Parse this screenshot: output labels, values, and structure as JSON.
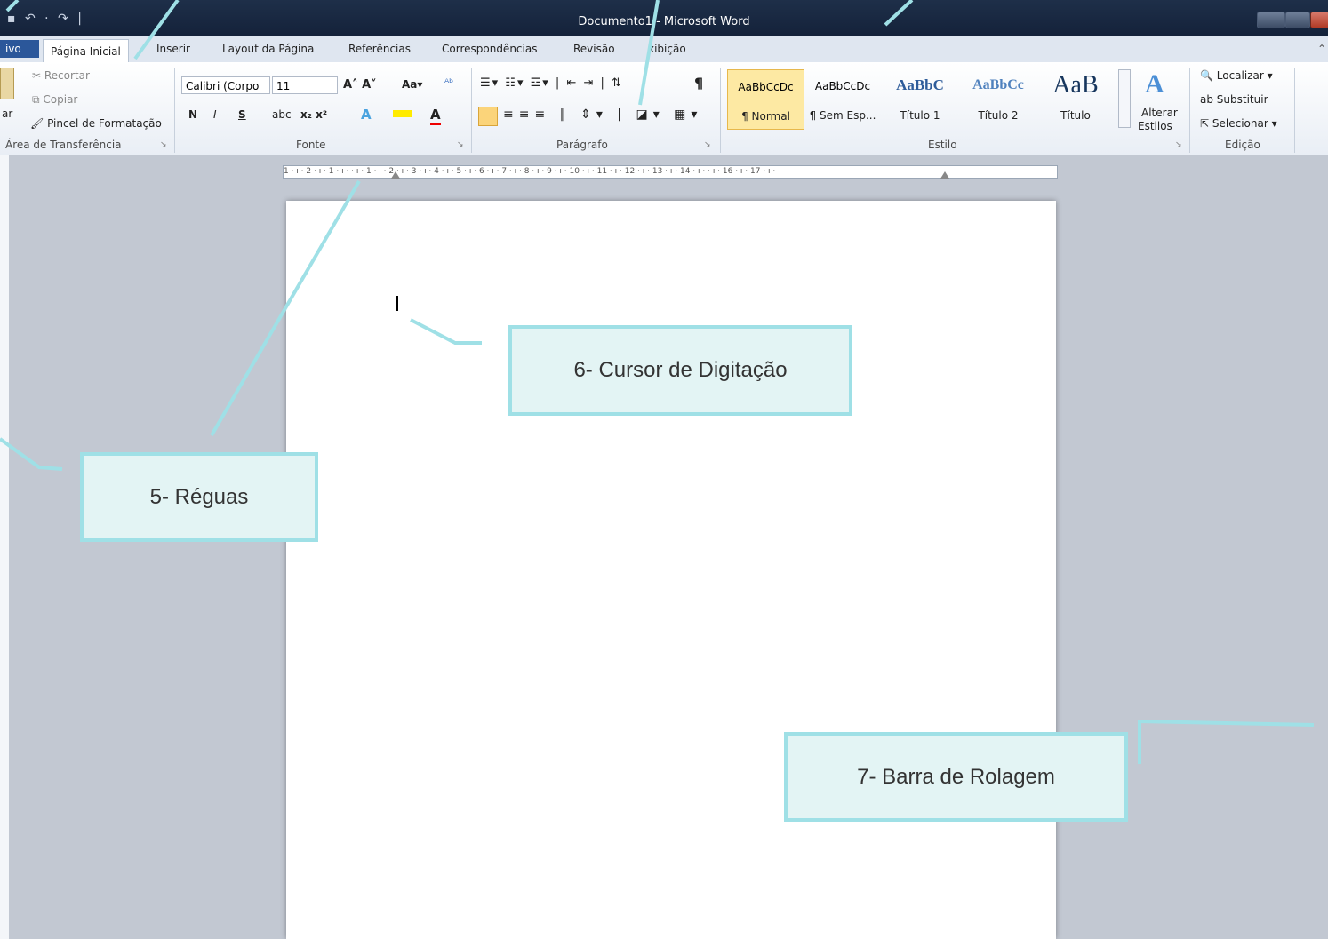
{
  "window": {
    "title": "Documento1 - Microsoft Word"
  },
  "tabs": [
    "ivo",
    "Página Inicial",
    "Inserir",
    "Layout da Página",
    "Referências",
    "Correspondências",
    "Revisão",
    "xibição"
  ],
  "clipboard": {
    "cut": "Recortar",
    "copy": "Copiar",
    "paste_partial": "ar",
    "format_painter": "Pincel de Formatação",
    "label": "Área de Transferência"
  },
  "font": {
    "name": "Calibri (Corpo",
    "size": "11",
    "bold": "N",
    "italic": "I",
    "underline": "S",
    "strike": "abc",
    "label": "Fonte"
  },
  "paragraph": {
    "label": "Parágrafo",
    "pilcrow": "¶"
  },
  "styles": {
    "items": [
      {
        "sample": "AaBbCcDc",
        "name": "¶ Normal"
      },
      {
        "sample": "AaBbCcDc",
        "name": "¶ Sem Esp..."
      },
      {
        "sample": "AaBbC",
        "name": "Título 1"
      },
      {
        "sample": "AaBbCc",
        "name": "Título 2"
      },
      {
        "sample": "AaB",
        "name": "Título"
      }
    ],
    "change_line1": "Alterar",
    "change_line2": "Estilos",
    "label": "Estilo"
  },
  "editing": {
    "find": "Localizar",
    "replace": "Substituir",
    "select": "Selecionar",
    "label": "Edição"
  },
  "ruler": {
    "ticks": "1 · ı · 2 · ı · 1 · ı ·   · ı · 1 · ı · 2 · ı · 3 · ı · 4 · ı · 5 · ı · 6 · ı · 7 · ı · 8 · ı · 9 · ı · 10 · ı · 11 · ı · 12 · ı · 13 · ı · 14 · ı ·   · ı · 16 · ı · 17 · ı ·"
  },
  "callouts": {
    "rulers": "5- Réguas",
    "cursor": "6- Cursor de Digitação",
    "scrollbar": "7- Barra de Rolagem"
  },
  "colors": {
    "accent": "#9fe0e6",
    "callout_bg": "#e3f4f4",
    "file_tab": "#2b579a"
  }
}
